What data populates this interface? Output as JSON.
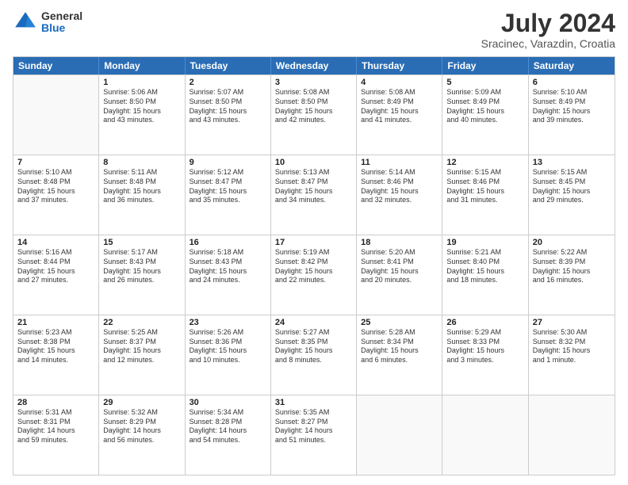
{
  "logo": {
    "general": "General",
    "blue": "Blue"
  },
  "title": "July 2024",
  "location": "Sracinec, Varazdin, Croatia",
  "weekdays": [
    "Sunday",
    "Monday",
    "Tuesday",
    "Wednesday",
    "Thursday",
    "Friday",
    "Saturday"
  ],
  "weeks": [
    [
      {
        "day": "",
        "info": ""
      },
      {
        "day": "1",
        "info": "Sunrise: 5:06 AM\nSunset: 8:50 PM\nDaylight: 15 hours\nand 43 minutes."
      },
      {
        "day": "2",
        "info": "Sunrise: 5:07 AM\nSunset: 8:50 PM\nDaylight: 15 hours\nand 43 minutes."
      },
      {
        "day": "3",
        "info": "Sunrise: 5:08 AM\nSunset: 8:50 PM\nDaylight: 15 hours\nand 42 minutes."
      },
      {
        "day": "4",
        "info": "Sunrise: 5:08 AM\nSunset: 8:49 PM\nDaylight: 15 hours\nand 41 minutes."
      },
      {
        "day": "5",
        "info": "Sunrise: 5:09 AM\nSunset: 8:49 PM\nDaylight: 15 hours\nand 40 minutes."
      },
      {
        "day": "6",
        "info": "Sunrise: 5:10 AM\nSunset: 8:49 PM\nDaylight: 15 hours\nand 39 minutes."
      }
    ],
    [
      {
        "day": "7",
        "info": "Sunrise: 5:10 AM\nSunset: 8:48 PM\nDaylight: 15 hours\nand 37 minutes."
      },
      {
        "day": "8",
        "info": "Sunrise: 5:11 AM\nSunset: 8:48 PM\nDaylight: 15 hours\nand 36 minutes."
      },
      {
        "day": "9",
        "info": "Sunrise: 5:12 AM\nSunset: 8:47 PM\nDaylight: 15 hours\nand 35 minutes."
      },
      {
        "day": "10",
        "info": "Sunrise: 5:13 AM\nSunset: 8:47 PM\nDaylight: 15 hours\nand 34 minutes."
      },
      {
        "day": "11",
        "info": "Sunrise: 5:14 AM\nSunset: 8:46 PM\nDaylight: 15 hours\nand 32 minutes."
      },
      {
        "day": "12",
        "info": "Sunrise: 5:15 AM\nSunset: 8:46 PM\nDaylight: 15 hours\nand 31 minutes."
      },
      {
        "day": "13",
        "info": "Sunrise: 5:15 AM\nSunset: 8:45 PM\nDaylight: 15 hours\nand 29 minutes."
      }
    ],
    [
      {
        "day": "14",
        "info": "Sunrise: 5:16 AM\nSunset: 8:44 PM\nDaylight: 15 hours\nand 27 minutes."
      },
      {
        "day": "15",
        "info": "Sunrise: 5:17 AM\nSunset: 8:43 PM\nDaylight: 15 hours\nand 26 minutes."
      },
      {
        "day": "16",
        "info": "Sunrise: 5:18 AM\nSunset: 8:43 PM\nDaylight: 15 hours\nand 24 minutes."
      },
      {
        "day": "17",
        "info": "Sunrise: 5:19 AM\nSunset: 8:42 PM\nDaylight: 15 hours\nand 22 minutes."
      },
      {
        "day": "18",
        "info": "Sunrise: 5:20 AM\nSunset: 8:41 PM\nDaylight: 15 hours\nand 20 minutes."
      },
      {
        "day": "19",
        "info": "Sunrise: 5:21 AM\nSunset: 8:40 PM\nDaylight: 15 hours\nand 18 minutes."
      },
      {
        "day": "20",
        "info": "Sunrise: 5:22 AM\nSunset: 8:39 PM\nDaylight: 15 hours\nand 16 minutes."
      }
    ],
    [
      {
        "day": "21",
        "info": "Sunrise: 5:23 AM\nSunset: 8:38 PM\nDaylight: 15 hours\nand 14 minutes."
      },
      {
        "day": "22",
        "info": "Sunrise: 5:25 AM\nSunset: 8:37 PM\nDaylight: 15 hours\nand 12 minutes."
      },
      {
        "day": "23",
        "info": "Sunrise: 5:26 AM\nSunset: 8:36 PM\nDaylight: 15 hours\nand 10 minutes."
      },
      {
        "day": "24",
        "info": "Sunrise: 5:27 AM\nSunset: 8:35 PM\nDaylight: 15 hours\nand 8 minutes."
      },
      {
        "day": "25",
        "info": "Sunrise: 5:28 AM\nSunset: 8:34 PM\nDaylight: 15 hours\nand 6 minutes."
      },
      {
        "day": "26",
        "info": "Sunrise: 5:29 AM\nSunset: 8:33 PM\nDaylight: 15 hours\nand 3 minutes."
      },
      {
        "day": "27",
        "info": "Sunrise: 5:30 AM\nSunset: 8:32 PM\nDaylight: 15 hours\nand 1 minute."
      }
    ],
    [
      {
        "day": "28",
        "info": "Sunrise: 5:31 AM\nSunset: 8:31 PM\nDaylight: 14 hours\nand 59 minutes."
      },
      {
        "day": "29",
        "info": "Sunrise: 5:32 AM\nSunset: 8:29 PM\nDaylight: 14 hours\nand 56 minutes."
      },
      {
        "day": "30",
        "info": "Sunrise: 5:34 AM\nSunset: 8:28 PM\nDaylight: 14 hours\nand 54 minutes."
      },
      {
        "day": "31",
        "info": "Sunrise: 5:35 AM\nSunset: 8:27 PM\nDaylight: 14 hours\nand 51 minutes."
      },
      {
        "day": "",
        "info": ""
      },
      {
        "day": "",
        "info": ""
      },
      {
        "day": "",
        "info": ""
      }
    ]
  ]
}
